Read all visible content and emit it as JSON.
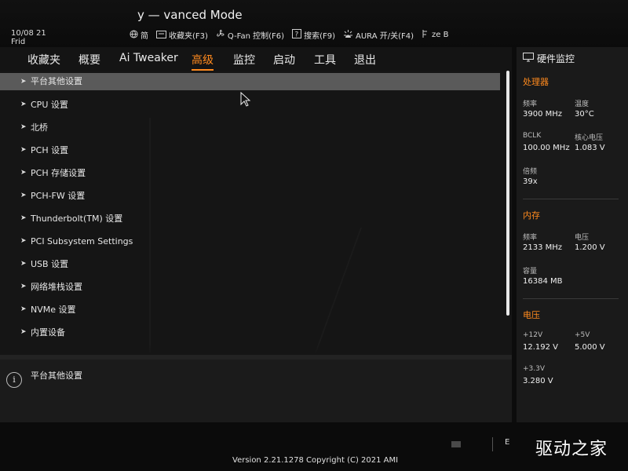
{
  "header": {
    "title": "y — vanced Mode",
    "date": "10/08 21",
    "day": "Frid",
    "toolbar": [
      {
        "icon": "globe-icon",
        "label": "简"
      },
      {
        "icon": "folder-icon",
        "label": "收藏夹(F3)"
      },
      {
        "icon": "fan-icon",
        "label": "Q-Fan 控制(F6)"
      },
      {
        "icon": "help-icon",
        "label": "搜索(F9)"
      },
      {
        "icon": "aura-icon",
        "label": "AURA 开/关(F4)"
      },
      {
        "icon": "resize-icon",
        "label": "ze B"
      }
    ]
  },
  "menu": {
    "items": [
      {
        "label": "收藏夹",
        "active": false
      },
      {
        "label": "概要",
        "active": false
      },
      {
        "label": "Ai Tweaker",
        "active": false
      },
      {
        "label": "高级",
        "active": true
      },
      {
        "label": "监控",
        "active": false
      },
      {
        "label": "启动",
        "active": false
      },
      {
        "label": "工具",
        "active": false
      },
      {
        "label": "退出",
        "active": false
      }
    ]
  },
  "list": [
    "平台其他设置",
    "CPU 设置",
    "北桥",
    "PCH 设置",
    "PCH 存储设置",
    "PCH-FW 设置",
    "Thunderbolt(TM) 设置",
    "PCI Subsystem Settings",
    "USB 设置",
    "网络堆栈设置",
    "NVMe 设置",
    "内置设备"
  ],
  "help": {
    "text": "平台其他设置"
  },
  "sidebar": {
    "title": "硬件监控",
    "cpu": {
      "heading": "处理器",
      "freq_label": "频率",
      "freq": "3900 MHz",
      "temp_label": "温度",
      "temp": "30°C",
      "bclk_label": "BCLK",
      "bclk": "100.00 MHz",
      "vcore_label": "核心电压",
      "vcore": "1.083 V",
      "ratio_label": "倍频",
      "ratio": "39x"
    },
    "mem": {
      "heading": "内存",
      "freq_label": "频率",
      "freq": "2133 MHz",
      "volt_label": "电压",
      "volt": "1.200 V",
      "cap_label": "容量",
      "cap": "16384 MB"
    },
    "volt": {
      "heading": "电压",
      "v12_label": "+12V",
      "v12": "12.192 V",
      "v5_label": "+5V",
      "v5": "5.000 V",
      "v33_label": "+3.3V",
      "v33": "3.280 V"
    }
  },
  "footer": {
    "version": "Version 2.21.1278 Copyright (C) 2021 AMI",
    "e_label": "E",
    "brand": "驱动之家"
  }
}
